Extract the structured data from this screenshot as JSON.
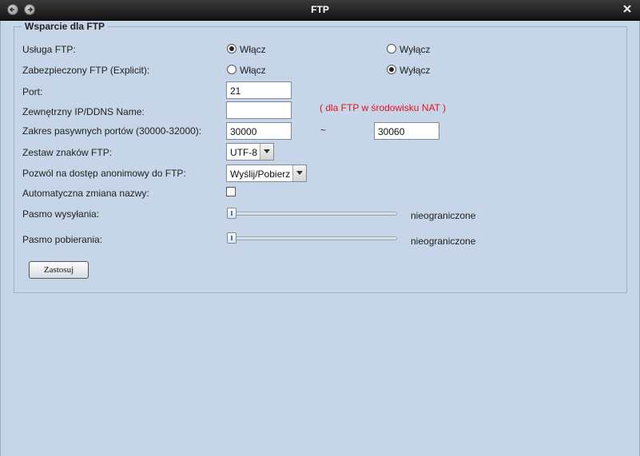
{
  "window": {
    "title": "FTP"
  },
  "section": {
    "legend": "Wsparcie dla FTP"
  },
  "ftp_service": {
    "label": "Usługa FTP:",
    "on_label": "Włącz",
    "off_label": "Wyłącz",
    "selected": "on"
  },
  "secure_ftp": {
    "label": "Zabezpieczony FTP (Explicit):",
    "on_label": "Włącz",
    "off_label": "Wyłącz",
    "selected": "off"
  },
  "port": {
    "label": "Port:",
    "value": "21"
  },
  "external_ip": {
    "label": "Zewnętrzny IP/DDNS Name:",
    "value": "",
    "note": "( dla FTP w środowisku NAT )"
  },
  "passive_ports": {
    "label": "Zakres pasywnych portów (30000-32000):",
    "start": "30000",
    "separator": "~",
    "end": "30060"
  },
  "charset": {
    "label": "Zestaw znaków FTP:",
    "value": "UTF-8"
  },
  "anonymous": {
    "label": "Pozwól na dostęp anonimowy do FTP:",
    "value": "Wyślij/Pobierz"
  },
  "auto_rename": {
    "label": "Automatyczna zmiana nazwy:",
    "checked": false
  },
  "upload_bandwidth": {
    "label": "Pasmo wysyłania:",
    "status": "nieograniczone",
    "level": 0
  },
  "download_bandwidth": {
    "label": "Pasmo pobierania:",
    "status": "nieograniczone",
    "level": 0
  },
  "apply_label": "Zastosuj",
  "icons": {
    "back": "back-arrow-icon",
    "forward": "forward-arrow-icon",
    "close": "close-icon",
    "dropdown": "chevron-down-icon"
  }
}
